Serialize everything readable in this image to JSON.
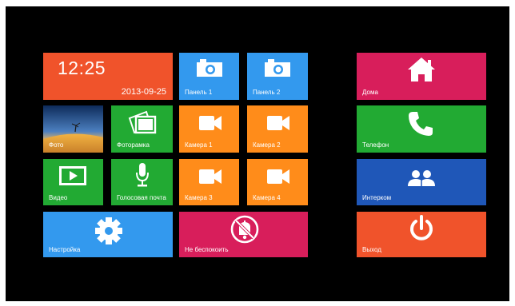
{
  "clock": {
    "time": "12:25",
    "date": "2013-09-25"
  },
  "tiles": {
    "panel1": "Панель 1",
    "panel2": "Панель 2",
    "photo": "Фото",
    "photoframe": "Фоторамка",
    "camera1": "Камера 1",
    "camera2": "Камера 2",
    "video": "Видео",
    "voicemail": "Голосовая почта",
    "camera3": "Камера 3",
    "camera4": "Камера 4",
    "settings": "Настройка",
    "dnd": "Не беспокоить",
    "home": "Дома",
    "phone": "Телефон",
    "intercom": "Интерком",
    "exit": "Выход"
  },
  "icons": {
    "panel": "camera-icon",
    "camera": "video-camera-icon",
    "photo": "landscape-photo-icon",
    "photoframe": "photo-frame-icon",
    "video": "play-icon",
    "voicemail": "microphone-icon",
    "settings": "gear-icon",
    "dnd": "do-not-disturb-icon",
    "home": "house-icon",
    "phone": "phone-handset-icon",
    "intercom": "people-icon",
    "exit": "power-icon"
  },
  "colors": {
    "red_orange": "#f0532b",
    "blue": "#3399ee",
    "orange": "#ff8c1a",
    "green": "#22aa33",
    "magenta": "#d81e5b",
    "dark_blue": "#1f57b8",
    "screen_bg": "#000000"
  }
}
